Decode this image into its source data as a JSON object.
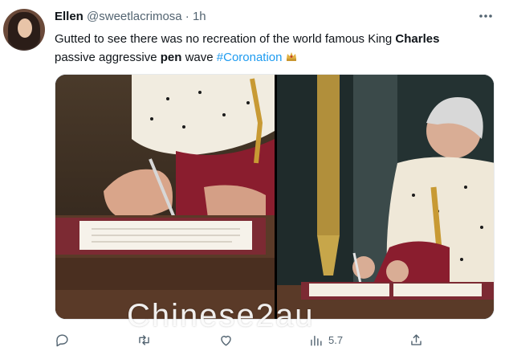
{
  "tweet": {
    "author_name": "Ellen",
    "handle": "@sweetlacrimosa",
    "separator": "·",
    "time": "1h",
    "text_parts": {
      "p1": "Gutted to see there was no recreation of the world famous King ",
      "b1": "Charles",
      "p2": "passive aggressive ",
      "b2": "pen",
      "p3": " wave ",
      "hashtag": "#Coronation"
    },
    "emoji": "crown-emoji"
  },
  "media": {
    "left_image": "king-signing-closeup",
    "right_image": "king-signing-wide"
  },
  "watermark": "Chinese2au",
  "actions": {
    "reply_count": "",
    "retweet_count": "",
    "like_count": "",
    "views_count": "",
    "share_count": "",
    "views_label": "5.7"
  },
  "icons": [
    "more-icon",
    "reply-icon",
    "retweet-icon",
    "like-icon",
    "views-icon",
    "share-icon"
  ],
  "colors": {
    "accent": "#1d9bf0",
    "text": "#0f1419",
    "muted": "#536471"
  }
}
